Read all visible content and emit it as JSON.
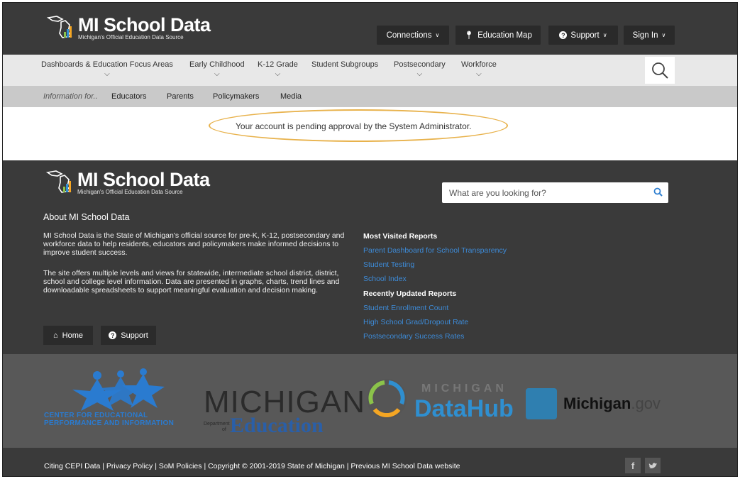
{
  "header": {
    "logo_title": "MI School Data",
    "logo_subtitle": "Michigan's Official Education Data Source",
    "buttons": {
      "connections": "Connections",
      "education_map": "Education Map",
      "support": "Support",
      "sign_in": "Sign In"
    }
  },
  "nav": {
    "items": [
      {
        "label": "Dashboards & Education Focus Areas"
      },
      {
        "label": "Early Childhood"
      },
      {
        "label": "K-12 Grade"
      },
      {
        "label": "Student Subgroups"
      },
      {
        "label": "Postsecondary"
      },
      {
        "label": "Workforce"
      }
    ]
  },
  "subnav": {
    "info_label": "Information for..",
    "items": [
      "Educators",
      "Parents",
      "Policymakers",
      "Media"
    ]
  },
  "message": "Your account is pending approval by the System Administrator.",
  "footer": {
    "logo_title": "MI School Data",
    "logo_subtitle": "Michigan's Official Education Data Source",
    "search_placeholder": "What are you looking for?",
    "about_title": "About MI School Data",
    "about_p1": "MI School Data is the State of Michigan's official source for pre-K, K-12, postsecondary and workforce data to help residents, educators and policymakers make informed decisions to improve student success.",
    "about_p2": "The site offers multiple levels and views for statewide, intermediate school district, district, school and college level information. Data are presented in graphs, charts, trend lines and downloadable spreadsheets to support meaningful evaluation and decision making.",
    "home_button": "Home",
    "support_button": "Support",
    "most_visited_title": "Most Visited Reports",
    "most_visited": [
      "Parent Dashboard for School Transparency",
      "Student Testing",
      "School Index"
    ],
    "recent_title": "Recently Updated Reports",
    "recent": [
      "Student Enrollment Count",
      "High School Grad/Dropout Rate",
      "Postsecondary Success Rates"
    ]
  },
  "partners": {
    "cepi_line1": "CENTER FOR EDUCATIONAL",
    "cepi_line2": "PERFORMANCE AND INFORMATION",
    "mde_word": "MICHIGAN",
    "mde_dept": "Department",
    "mde_of": "of",
    "mde_edu": "Education",
    "datahub_top": "MICHIGAN",
    "datahub_word": "DataHub",
    "mgov_main": "Michigan",
    "mgov_suffix": ".gov"
  },
  "bottom": {
    "links": "Citing CEPI Data | Privacy Policy | SoM Policies | Copyright © 2001-2019 State of Michigan | Previous MI School Data website",
    "facebook": "f",
    "twitter": "t"
  },
  "colors": {
    "header_bg": "#3a3a3a",
    "nav_bg": "#e8e8e8",
    "subnav_bg": "#c9c9c9",
    "link_blue": "#3d8bd8",
    "highlight": "#e8b24c"
  }
}
